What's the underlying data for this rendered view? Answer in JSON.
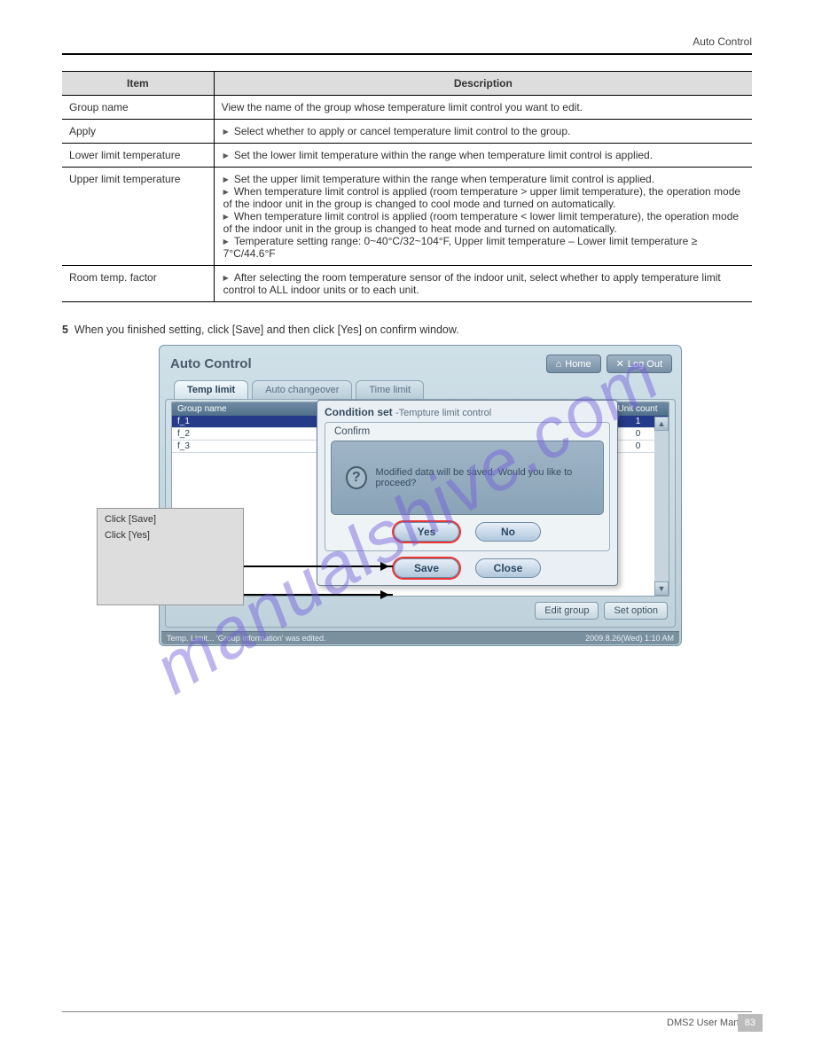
{
  "header": {
    "breadcrumb": "Auto Control"
  },
  "spec_table": {
    "headers": [
      "Item",
      "Description"
    ],
    "rows": [
      {
        "item": "Group name",
        "desc": "View the name of the group whose temperature limit control you want to edit."
      },
      {
        "item": "Apply",
        "desc_list": [
          "Select whether to apply or cancel temperature limit control to the group."
        ]
      },
      {
        "item": "Lower limit temperature",
        "desc_list": [
          "Set the lower limit temperature within the range when temperature limit control is applied."
        ]
      },
      {
        "item": "Upper limit temperature",
        "desc_list": [
          "Set the upper limit temperature within the range when temperature limit control is applied.",
          "When temperature limit control is applied (room temperature > upper limit temperature), the operation mode of the indoor unit in the group is changed to cool mode and turned on automatically.",
          "When temperature limit control is applied (room temperature < lower limit temperature), the operation mode of the indoor unit in the group is changed to heat mode and turned on automatically.",
          "Temperature setting range: 0~40°C/32~104°F, Upper limit temperature – Lower limit temperature ≥ 7°C/44.6°F"
        ]
      },
      {
        "item": "Room temp. factor",
        "desc_list": [
          "After selecting the room temperature sensor of the indoor unit, select whether to apply temperature limit control to ALL indoor units or to each unit."
        ]
      }
    ]
  },
  "step": {
    "num": "5",
    "text": "When you finished setting, click [Save] and then click [Yes] on confirm window."
  },
  "app": {
    "title": "Auto Control",
    "home": "Home",
    "logout": "Log Out",
    "tabs": {
      "temp": "Temp limit",
      "auto": "Auto changeover",
      "time": "Time limit"
    },
    "grid": {
      "header_name": "Group name",
      "header_count": "Unit count",
      "rows": [
        {
          "name": "f_1",
          "count": "1",
          "selected": true
        },
        {
          "name": "f_2",
          "count": "0"
        },
        {
          "name": "f_3",
          "count": "0"
        }
      ]
    },
    "edit_group": "Edit group",
    "set_option": "Set option",
    "status_left": "Temp. Limit... 'Group information' was edited.",
    "status_right": "2009.8.26(Wed)  1:10 AM"
  },
  "cond_dialog": {
    "title": "Condition set",
    "subtitle": "-Tempture limit control",
    "save": "Save",
    "close": "Close"
  },
  "confirm": {
    "title": "Confirm",
    "message": "Modified data will be saved.  Would you like to proceed?",
    "yes": "Yes",
    "no": "No"
  },
  "callout": {
    "line1": "Click [Save]",
    "line2": "Click [Yes]"
  },
  "footer": {
    "left": "",
    "right": "DMS2 User Manual"
  },
  "page_number": "83",
  "watermark": "manualshive.com"
}
